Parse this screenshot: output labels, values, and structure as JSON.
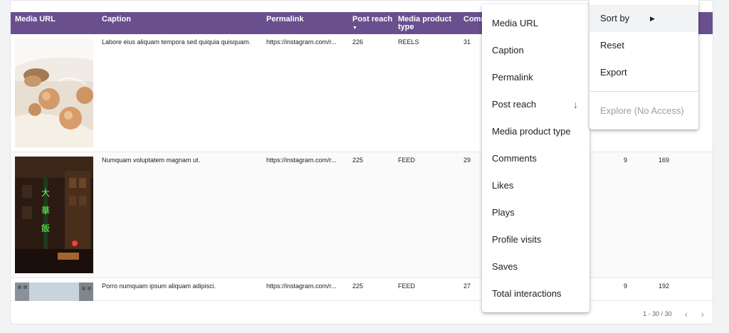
{
  "table": {
    "headers": {
      "media_url": "Media URL",
      "caption": "Caption",
      "permalink": "Permalink",
      "post_reach": "Post reach",
      "media_type": "Media product type",
      "comments_partial": "Comm"
    },
    "rows": [
      {
        "caption": "Labore eius aliquam tempora sed quiquia quisquam.",
        "permalink": "https://instagram.com/r...",
        "reach": "226",
        "type": "REELS",
        "comments": "31",
        "col_a": "",
        "col_b": ""
      },
      {
        "caption": "Numquam voluptatem magnam ut.",
        "permalink": "https://instagram.com/r...",
        "reach": "225",
        "type": "FEED",
        "comments": "29",
        "col_a": "9",
        "col_b": "169"
      },
      {
        "caption": "Porro numquam ipsum aliquam adipisci.",
        "permalink": "https://instagram.com/r...",
        "reach": "225",
        "type": "FEED",
        "comments": "27",
        "col_a": "9",
        "col_b": "192"
      }
    ],
    "pagination": "1 - 30 / 30"
  },
  "column_menu": {
    "items": [
      "Media URL",
      "Caption",
      "Permalink",
      "Post reach",
      "Media product type",
      "Comments",
      "Likes",
      "Plays",
      "Profile visits",
      "Saves",
      "Total interactions"
    ]
  },
  "context_menu": {
    "sort_by": "Sort by",
    "reset": "Reset",
    "export": "Export",
    "explore": "Explore (No Access)"
  },
  "colors": {
    "header_bg": "#6a4f8f",
    "menu_bg": "#ffffff",
    "disabled_text": "#9aa0a6"
  },
  "icons": {
    "sort_desc": "arrow-down-icon",
    "submenu": "triangle-right-icon",
    "prev_page": "chevron-left-icon",
    "next_page": "chevron-right-icon"
  }
}
